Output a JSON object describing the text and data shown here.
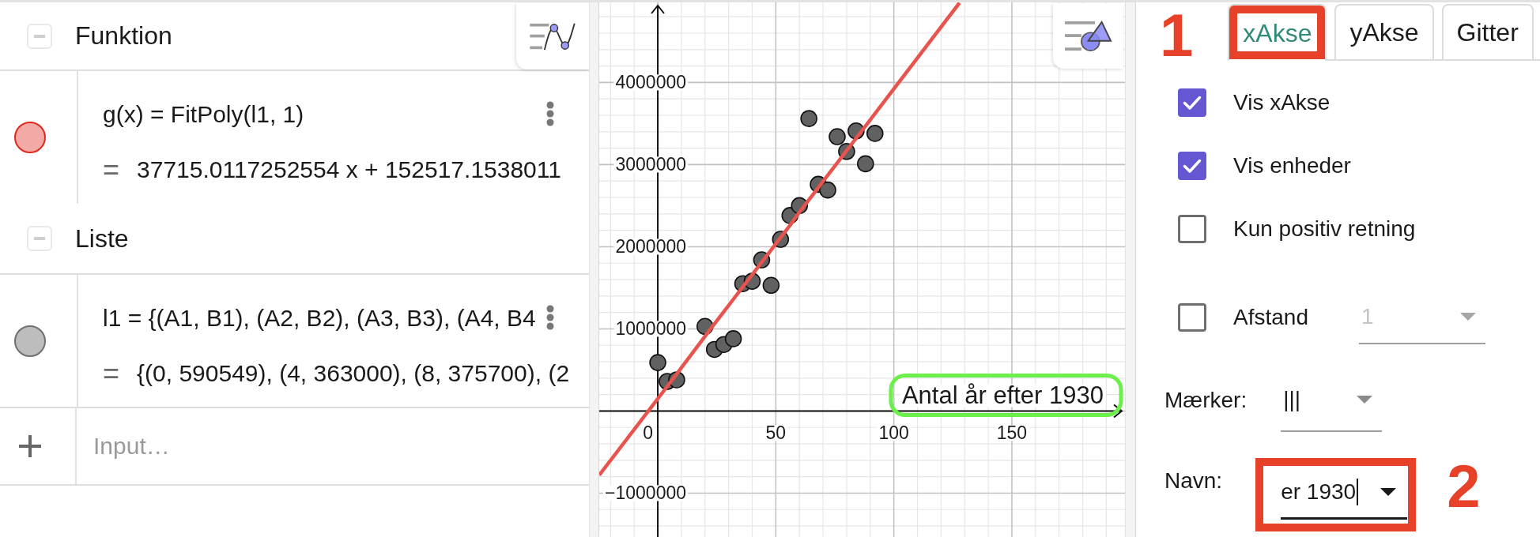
{
  "algebra_view": {
    "sections": [
      {
        "title": "Funktion",
        "expanded": true,
        "items": [
          {
            "definition": "g(x) = FitPoly(l1, 1)",
            "output_sign": "=",
            "output": "37715.0117252554 x + 152517.1538011",
            "color": "#f3a9a5"
          }
        ]
      },
      {
        "title": "Liste",
        "expanded": true,
        "items": [
          {
            "definition": "l1 = {(A1, B1), (A2, B2), (A3, B3), (A4, B4",
            "output_sign": "=",
            "output": "{(0, 590549), (4, 363000), (8, 375700), (2",
            "color": "#bdbdbd"
          }
        ]
      }
    ],
    "input": {
      "placeholder": "Input…"
    }
  },
  "graphics_view": {
    "axis_label_highlighted": true,
    "chart_data": {
      "type": "scatter",
      "grid": true,
      "xlabel": "Antal år efter 1930",
      "x": [
        -24.8,
        0,
        4,
        8,
        20,
        24,
        28,
        32,
        36,
        40,
        44,
        48,
        52,
        56,
        60,
        64,
        68,
        72,
        76,
        80,
        84,
        88,
        92,
        127.8
      ],
      "series": [
        {
          "color": "#616161",
          "values": [
            null,
            590000,
            360000,
            380000,
            1030000,
            750000,
            810000,
            880000,
            1550000,
            1580000,
            1840000,
            1530000,
            2090000,
            2380000,
            2500000,
            3560000,
            2760000,
            2690000,
            3340000,
            3160000,
            3410000,
            3010000,
            3380000,
            null
          ]
        },
        {
          "type": "line",
          "color": "#e9534d",
          "values": [
            -780000,
            150000,
            300000,
            450000,
            910000,
            1060000,
            1210000,
            1360000,
            1510000,
            1660000,
            1810000,
            1960000,
            2110000,
            2260000,
            2420000,
            2570000,
            2720000,
            2870000,
            3020000,
            3170000,
            3320000,
            3470000,
            3620000,
            4970000
          ]
        }
      ],
      "xlim": [
        -24.8,
        197.9
      ],
      "ylim": [
        -1534000,
        4975000
      ],
      "xticks": [
        0,
        50,
        100,
        150
      ],
      "yticks": [
        {
          "value": -1000000,
          "label": "−1000000"
        },
        1000000,
        2000000,
        3000000,
        4000000
      ]
    }
  },
  "settings": {
    "tab_callout": "1",
    "tabs": [
      {
        "label": "xAkse",
        "selected": true,
        "highlighted": true
      },
      {
        "label": "yAkse",
        "selected": false,
        "highlighted": false
      },
      {
        "label": "Gitter",
        "selected": false,
        "highlighted": false
      }
    ],
    "options": [
      {
        "kind": "checkbox",
        "label": "Vis xAkse",
        "checked": true
      },
      {
        "kind": "checkbox",
        "label": "Vis enheder",
        "checked": true
      },
      {
        "kind": "checkbox",
        "label": "Kun positiv retning",
        "checked": false
      },
      {
        "kind": "checkbox_dropdown",
        "label": "Afstand",
        "checked": false,
        "value": "1",
        "disabled": true
      },
      {
        "kind": "dropdown",
        "label": "Mærker:",
        "value": "|||"
      },
      {
        "kind": "combo",
        "label": "Navn:",
        "value": "er 1930",
        "focused": true,
        "highlighted": true,
        "callout": "2"
      }
    ]
  }
}
